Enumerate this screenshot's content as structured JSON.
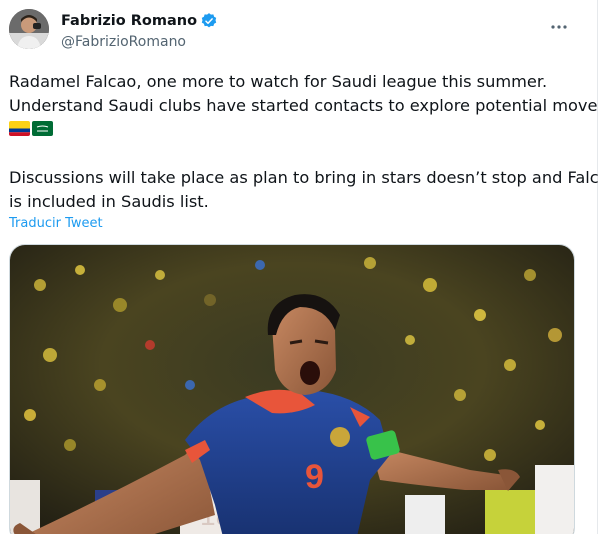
{
  "author": {
    "display_name": "Fabrizio Romano",
    "handle": "@FabrizioRomano",
    "verified": true,
    "avatar_icon": "avatar"
  },
  "tweet": {
    "line1": "Radamel Falcao, one more to watch for Saudi league this summer.",
    "line2": "Understand Saudi clubs have started contacts to explore potential move.",
    "flags": [
      "colombia-flag-icon",
      "saudi-arabia-flag-icon"
    ],
    "line3": "Discussions will take place as plan to bring in stars doesn’t stop and Falcao",
    "line4": "is included in Saudis list."
  },
  "translate_label": "Traducir Tweet",
  "jersey_number": "9",
  "colors": {
    "link": "#1d9bf0",
    "verified": "#1d9bf0",
    "jersey": "#1f3f8f",
    "jersey_trim": "#e8553a",
    "armband": "#38c24a"
  }
}
